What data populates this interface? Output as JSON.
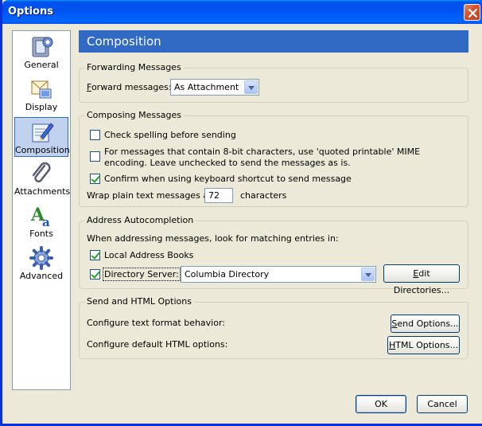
{
  "window": {
    "title": "Options"
  },
  "nav": {
    "items": [
      {
        "label": "General",
        "icon": "general-icon"
      },
      {
        "label": "Display",
        "icon": "display-icon"
      },
      {
        "label": "Composition",
        "icon": "composition-icon",
        "selected": true
      },
      {
        "label": "Attachments",
        "icon": "paperclip-icon"
      },
      {
        "label": "Fonts",
        "icon": "fonts-icon"
      },
      {
        "label": "Advanced",
        "icon": "gear-icon"
      }
    ]
  },
  "header": {
    "title": "Composition"
  },
  "forwarding": {
    "legend": "Forwarding Messages",
    "label_prefix": "F",
    "label_rest": "orward messages:",
    "value": "As Attachment"
  },
  "composing": {
    "legend": "Composing Messages",
    "spell_check": {
      "label": "Check spelling before sending",
      "checked": false
    },
    "quoted_printable": {
      "label": "For messages that contain 8-bit characters, use 'quoted printable' MIME encoding. Leave unchecked to send the messages as is.",
      "checked": false
    },
    "confirm_shortcut": {
      "label": "Confirm when using keyboard shortcut to send message",
      "checked": true
    },
    "wrap_label": "Wrap plain text messages at",
    "wrap_value": "72",
    "wrap_unit": "characters"
  },
  "autocomplete": {
    "legend": "Address Autocompletion",
    "intro": "When addressing messages, look for matching entries in:",
    "local_books": {
      "label": "Local Address Books",
      "checked": true
    },
    "directory_server": {
      "label": "Directory Server:",
      "checked": true,
      "value": "Columbia Directory"
    },
    "edit_directories_label_prefix": "E",
    "edit_directories_label_rest": "dit Directories..."
  },
  "send_html": {
    "legend": "Send and HTML Options",
    "text_format_label": "Configure text format behavior:",
    "send_options_prefix": "S",
    "send_options_rest": "end Options...",
    "html_label": "Configure default HTML options:",
    "html_options_prefix": "H",
    "html_options_rest": "TML Options..."
  },
  "footer": {
    "ok": "OK",
    "cancel": "Cancel"
  }
}
